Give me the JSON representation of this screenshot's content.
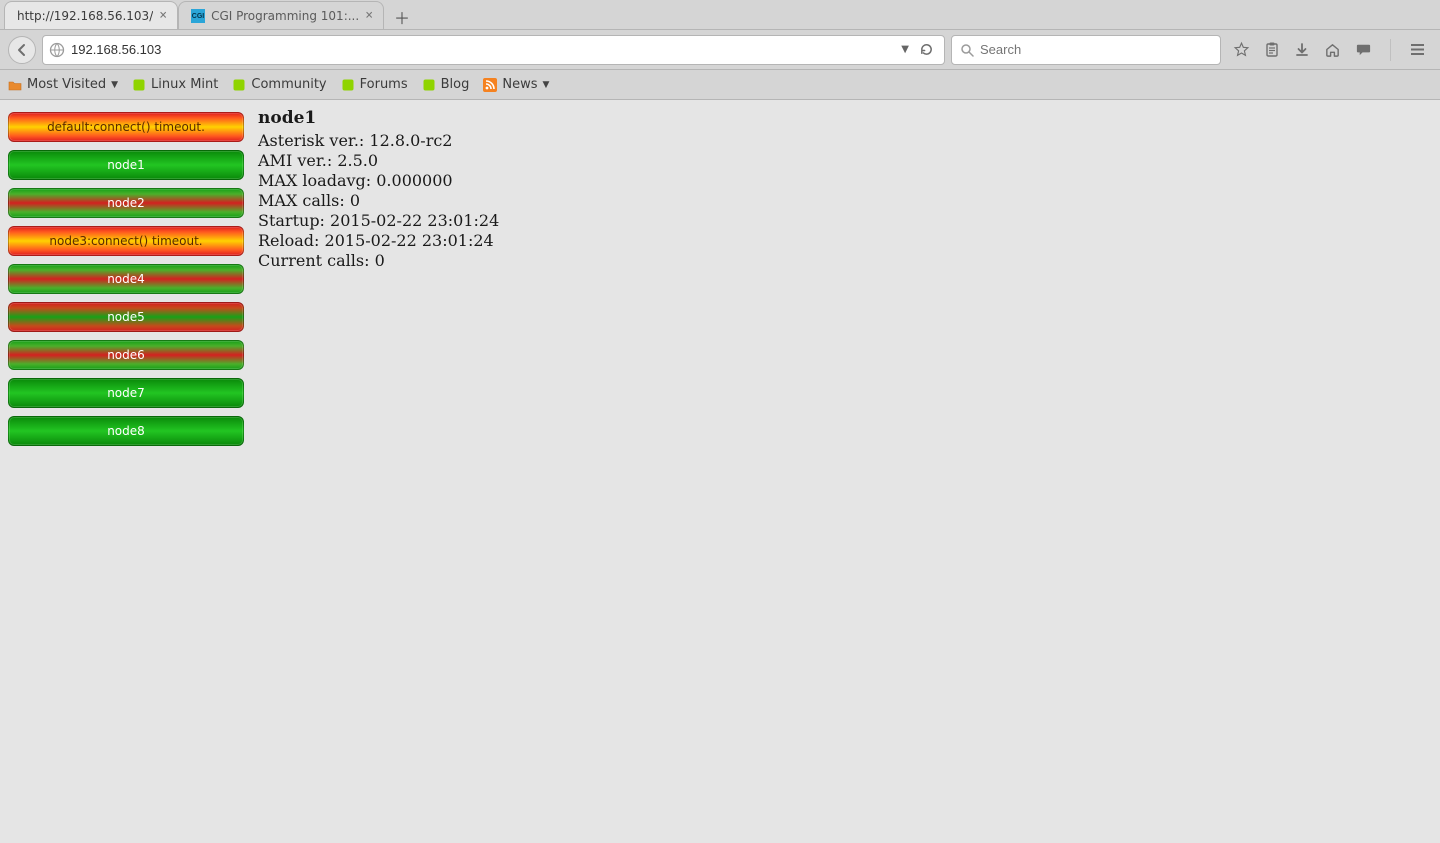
{
  "tabs": [
    {
      "title": "http://192.168.56.103/",
      "active": true
    },
    {
      "title": "CGI Programming 101:...",
      "active": false
    }
  ],
  "url": "192.168.56.103",
  "search_placeholder": "Search",
  "bookmarks": {
    "most_visited": "Most Visited",
    "linux_mint": "Linux Mint",
    "community": "Community",
    "forums": "Forums",
    "blog": "Blog",
    "news": "News"
  },
  "nodes": [
    {
      "label": "default:connect() timeout.",
      "style": "grad-ryr"
    },
    {
      "label": "node1",
      "style": "grad-green"
    },
    {
      "label": "node2",
      "style": "grad-grg"
    },
    {
      "label": "node3:connect() timeout.",
      "style": "grad-ryr"
    },
    {
      "label": "node4",
      "style": "grad-grg"
    },
    {
      "label": "node5",
      "style": "grad-rgr"
    },
    {
      "label": "node6",
      "style": "grad-grg"
    },
    {
      "label": "node7",
      "style": "grad-green"
    },
    {
      "label": "node8",
      "style": "grad-green"
    }
  ],
  "detail": {
    "title": "node1",
    "asterisk_ver_label": "Asterisk ver.:",
    "asterisk_ver": "12.8.0-rc2",
    "ami_ver_label": "AMI ver.:",
    "ami_ver": "2.5.0",
    "max_loadavg_label": "MAX loadavg:",
    "max_loadavg": "0.000000",
    "max_calls_label": "MAX calls:",
    "max_calls": "0",
    "startup_label": "Startup:",
    "startup": "2015-02-22 23:01:24",
    "reload_label": "Reload:",
    "reload": "2015-02-22 23:01:24",
    "current_calls_label": "Current calls:",
    "current_calls": "0"
  }
}
